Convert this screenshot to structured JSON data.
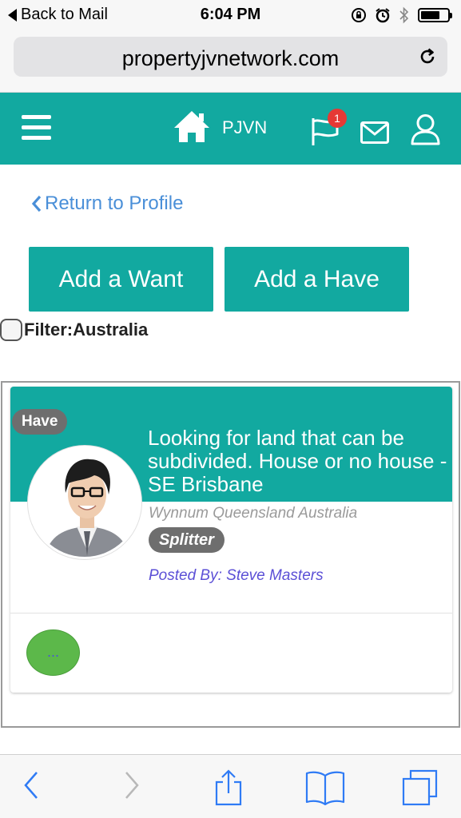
{
  "status_bar": {
    "back_label": "Back to Mail",
    "time": "6:04 PM",
    "battery_level": 0.72
  },
  "browser": {
    "url": "propertyjvnetwork.com"
  },
  "header": {
    "brand": "PJVN",
    "notification_count": "1",
    "icons": [
      "menu-icon",
      "home-icon",
      "flag-icon",
      "mail-icon",
      "user-icon"
    ],
    "background_color": "#12a9a0"
  },
  "page": {
    "return_link": "Return to Profile",
    "add_want_label": "Add a Want",
    "add_have_label": "Add a Have",
    "filter_label": "Filter:Australia",
    "filter_checked": false
  },
  "listing": {
    "type": "Have",
    "title": "Looking for land that can be subdivided. House or no house - SE Brisbane",
    "location": "Wynnum Queensland Australia",
    "tag": "Splitter",
    "posted_by": "Posted By: Steve Masters",
    "more_label": "..."
  },
  "colors": {
    "accent": "#12a9a0",
    "link": "#4a8fd8",
    "badge": "#e53935",
    "more_button": "#5cb84a"
  }
}
